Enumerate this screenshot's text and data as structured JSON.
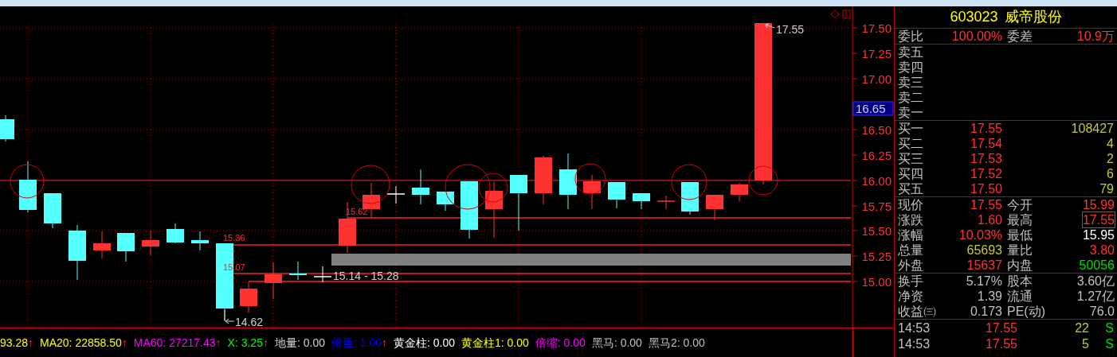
{
  "chart": {
    "y_axis_labels": [
      "17.50",
      "17.25",
      "17.00",
      "16.50",
      "16.25",
      "16.00",
      "15.75",
      "15.50",
      "15.25",
      "15.00"
    ],
    "current_price": "16.65",
    "annotations": [
      {
        "kind": "peak",
        "text": "17.55"
      },
      {
        "kind": "level",
        "text": "15.62"
      },
      {
        "kind": "level",
        "text": "15.36"
      },
      {
        "kind": "level",
        "text": "15.07"
      },
      {
        "kind": "range",
        "text": "15.14 - 15.28"
      },
      {
        "kind": "trough",
        "text": "14.62"
      }
    ]
  },
  "indicators": [
    {
      "text": "93.28",
      "arrow": "↑",
      "color": "#ffff00"
    },
    {
      "text": "MA20: 22858.50",
      "arrow": "↑",
      "color": "#ffff00"
    },
    {
      "text": "MA60: 27217.43",
      "arrow": "↑",
      "color": "#ff00ff"
    },
    {
      "text": "X: 3.25",
      "arrow": "↑",
      "color": "#00ff00"
    },
    {
      "text": "地量: 0.00",
      "color": "#d0d0d0"
    },
    {
      "text": "倍量: 1.00",
      "arrow": "↑",
      "color": "#0000ff"
    },
    {
      "text": "黄金柱: 0.00",
      "color": "#ffffff"
    },
    {
      "text": "黄金柱1: 0.00",
      "color": "#ffff00"
    },
    {
      "text": "倍缩: 0.00",
      "color": "#ff00ff"
    },
    {
      "text": "黑马: 0.00",
      "color": "#c0c0c0"
    },
    {
      "text": "黑马2: 0.00",
      "color": "#c0c0c0"
    }
  ],
  "quote": {
    "code": "603023",
    "name": "威帝股份",
    "ratio": [
      {
        "label": "委比",
        "value": "100.00%"
      },
      {
        "label": "委差",
        "value": "10.9万"
      }
    ],
    "asks": [
      {
        "label": "卖五"
      },
      {
        "label": "卖四"
      },
      {
        "label": "卖三"
      },
      {
        "label": "卖二"
      },
      {
        "label": "卖一"
      }
    ],
    "bids": [
      {
        "label": "买一",
        "price": "17.55",
        "volume": "108427"
      },
      {
        "label": "买二",
        "price": "17.54",
        "volume": "4"
      },
      {
        "label": "买三",
        "price": "17.53",
        "volume": "2"
      },
      {
        "label": "买四",
        "price": "17.52",
        "volume": "6"
      },
      {
        "label": "买五",
        "price": "17.50",
        "volume": "79"
      }
    ],
    "stats": [
      {
        "label": "现价",
        "value": "17.55",
        "color": "#ff3232",
        "boxed": false
      },
      {
        "label": "今开",
        "value": "15.99",
        "color": "#ff3232",
        "boxed": false
      },
      {
        "label": "涨跌",
        "value": "1.60",
        "color": "#ff3232",
        "boxed": false
      },
      {
        "label": "最高",
        "value": "17.55",
        "color": "#ff3232",
        "boxed": true
      },
      {
        "label": "涨幅",
        "value": "10.03%",
        "color": "#ff3232",
        "boxed": false
      },
      {
        "label": "最低",
        "value": "15.95",
        "color": "#ffffff",
        "boxed": false
      },
      {
        "label": "总量",
        "value": "65693",
        "color": "#c8c832",
        "boxed": false
      },
      {
        "label": "量比",
        "value": "3.80",
        "color": "#ff3232",
        "boxed": false
      },
      {
        "label": "外盘",
        "value": "15637",
        "color": "#ff3232",
        "boxed": false
      },
      {
        "label": "内盘",
        "value": "50056",
        "color": "#00e000",
        "boxed": false
      }
    ],
    "fundamentals": [
      {
        "label": "换手",
        "value": "5.17%"
      },
      {
        "label": "股本",
        "value": "3.60亿"
      },
      {
        "label": "净资",
        "value": "1.39"
      },
      {
        "label": "流通",
        "value": "1.27亿"
      },
      {
        "label": "收益㈢",
        "value": "0.173"
      },
      {
        "label": "PE(动)",
        "value": "76.0"
      }
    ],
    "ticks": [
      {
        "time": "14:53",
        "price": "17.55",
        "volume": "22",
        "side": "S"
      },
      {
        "time": "14:53",
        "price": "17.55",
        "volume": "5",
        "side": "S"
      }
    ]
  }
}
